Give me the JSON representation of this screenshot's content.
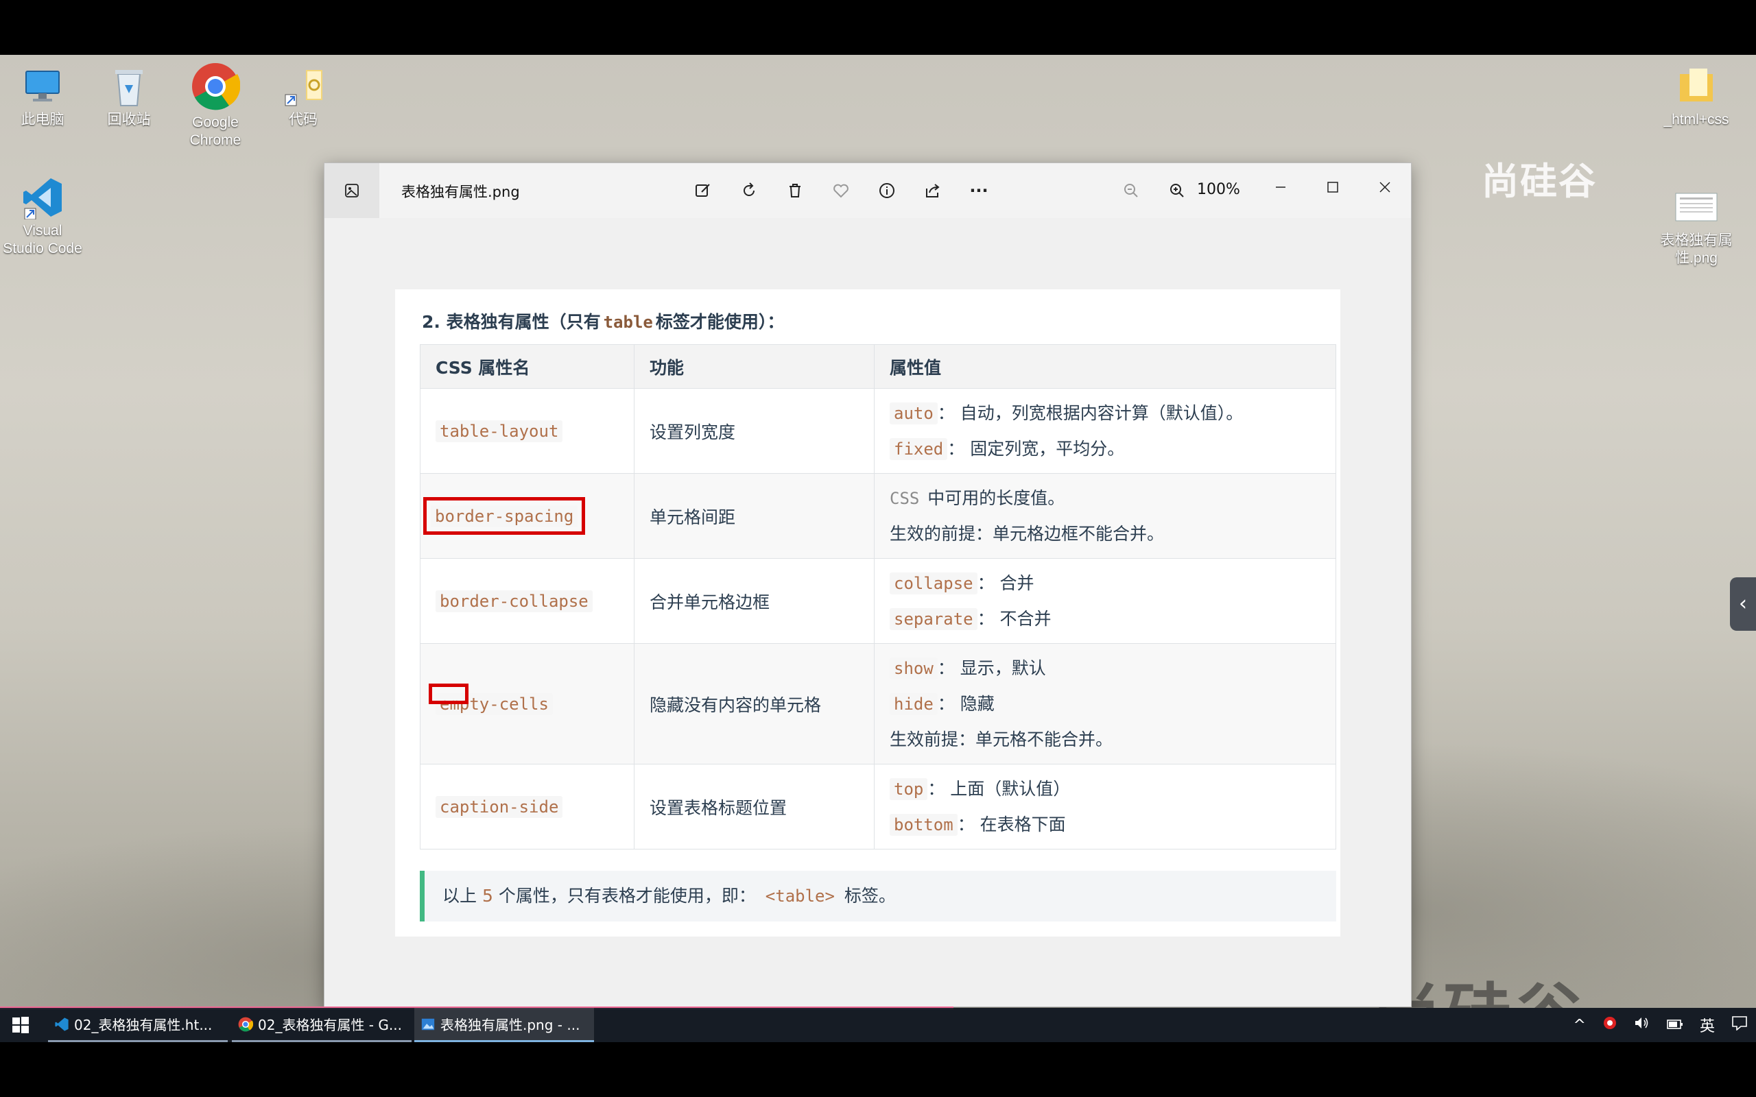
{
  "desktop": {
    "icons": [
      {
        "label": "此电脑",
        "icon": "computer-icon"
      },
      {
        "label": "回收站",
        "icon": "recycle-bin-icon"
      },
      {
        "label": "Google Chrome",
        "icon": "chrome-icon"
      },
      {
        "label": "代码",
        "icon": "folder-shortcut-icon"
      },
      {
        "label": "Visual Studio Code",
        "icon": "vscode-icon"
      }
    ],
    "right_icons": [
      {
        "label": "_html+css",
        "icon": "folder-icon"
      },
      {
        "label": "表格独有属性.png",
        "icon": "image-file-icon"
      }
    ],
    "watermark_top": "尚硅谷",
    "watermark_bottom": "尚硅谷"
  },
  "viewer": {
    "file_name": "表格独有属性.png",
    "zoom": "100%",
    "toolbar_icons": [
      "edit-image-icon",
      "rotate-icon",
      "delete-icon",
      "favorite-icon",
      "info-icon",
      "share-icon",
      "more-icon"
    ]
  },
  "content": {
    "heading_prefix": "2. 表格独有属性（只有",
    "heading_code": "table",
    "heading_suffix": "标签才能使用）：",
    "columns": [
      "CSS 属性名",
      "功能",
      "属性值"
    ],
    "rows": [
      {
        "name": "table-layout",
        "function": "设置列宽度",
        "values": [
          {
            "code": "auto",
            "text": "： 自动，列宽根据内容计算（默认值）。"
          },
          {
            "code": "fixed",
            "text": "： 固定列宽，平均分。"
          }
        ]
      },
      {
        "name": "border-spacing",
        "function": "单元格间距",
        "values": [
          {
            "code": "CSS",
            "text": " 中可用的长度值。"
          },
          {
            "code": "",
            "text": "生效的前提：单元格边框不能合并。"
          }
        ]
      },
      {
        "name": "border-collapse",
        "function": "合并单元格边框",
        "values": [
          {
            "code": "collapse",
            "text": "： 合并"
          },
          {
            "code": "separate",
            "text": "： 不合并"
          }
        ]
      },
      {
        "name": "empty-cells",
        "function": "隐藏没有内容的单元格",
        "values": [
          {
            "code": "show",
            "text": "： 显示，默认"
          },
          {
            "code": "hide",
            "text": "： 隐藏"
          },
          {
            "code": "",
            "text": "生效前提：单元格不能合并。"
          }
        ]
      },
      {
        "name": "caption-side",
        "function": "设置表格标题位置",
        "values": [
          {
            "code": "top",
            "text": "： 上面（默认值）"
          },
          {
            "code": "bottom",
            "text": "： 在表格下面"
          }
        ]
      }
    ],
    "note_prefix": "以上",
    "note_count": "5",
    "note_mid": "个属性，只有表格才能使用，即：",
    "note_code": "<table>",
    "note_suffix": "标签。"
  },
  "taskbar": {
    "tasks": [
      {
        "label": "02_表格独有属性.ht...",
        "icon": "vscode-icon"
      },
      {
        "label": "02_表格独有属性 - G...",
        "icon": "chrome-icon"
      },
      {
        "label": "表格独有属性.png - ...",
        "icon": "photos-icon"
      }
    ],
    "ime": "英"
  },
  "colors": {
    "highlight": "#d60000",
    "note_border": "#42b983",
    "code_text": "#b0704a",
    "progress": "#f06a96"
  }
}
